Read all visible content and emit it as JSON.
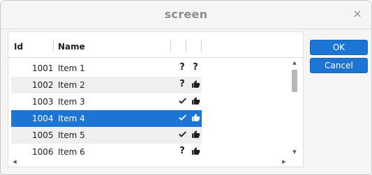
{
  "window": {
    "title": "screen",
    "close_glyph": "×"
  },
  "table": {
    "columns": [
      "Id",
      "Name",
      "",
      ""
    ],
    "rows": [
      {
        "id": "1001",
        "name": "Item 1",
        "c1": "?",
        "c2": "?",
        "c1_icon": "question-icon",
        "c2_icon": "question-icon",
        "selected": false
      },
      {
        "id": "1002",
        "name": "Item 2",
        "c1": "?",
        "c2": "",
        "c1_icon": "question-icon",
        "c2_icon": "thumbs-up-icon",
        "selected": false
      },
      {
        "id": "1003",
        "name": "Item 3",
        "c1": "",
        "c2": "",
        "c1_icon": "check-icon",
        "c2_icon": "thumbs-up-icon",
        "selected": false
      },
      {
        "id": "1004",
        "name": "Item 4",
        "c1": "",
        "c2": "",
        "c1_icon": "check-icon",
        "c2_icon": "thumbs-up-icon",
        "selected": true
      },
      {
        "id": "1005",
        "name": "Item 5",
        "c1": "",
        "c2": "",
        "c1_icon": "check-icon",
        "c2_icon": "thumbs-up-icon",
        "selected": false
      },
      {
        "id": "1006",
        "name": "Item 6",
        "c1": "?",
        "c2": "",
        "c1_icon": "question-icon",
        "c2_icon": "thumbs-up-icon",
        "selected": false
      }
    ]
  },
  "buttons": {
    "ok_label": "OK",
    "cancel_label": "Cancel"
  },
  "colors": {
    "accent": "#1c74d4"
  }
}
